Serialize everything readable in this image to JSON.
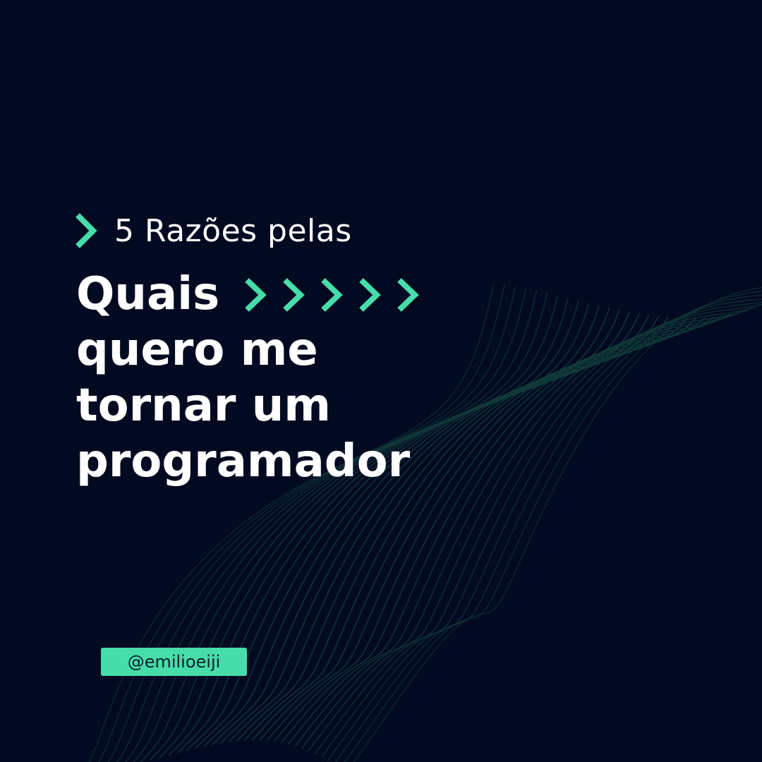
{
  "theme": {
    "background": "#020a21",
    "accent": "#47ddaa",
    "text": "#ffffff",
    "wave_lines": "#123a3a"
  },
  "eyebrow": {
    "icon": "chevron-right-icon",
    "text": "5 Razões pelas"
  },
  "headline": {
    "lines": [
      "Quais",
      "quero me",
      "tornar um",
      "programador"
    ],
    "decoration_icon": "chevron-right-icon",
    "decoration_count": 5
  },
  "handle": {
    "text": "@emilioeiji"
  }
}
